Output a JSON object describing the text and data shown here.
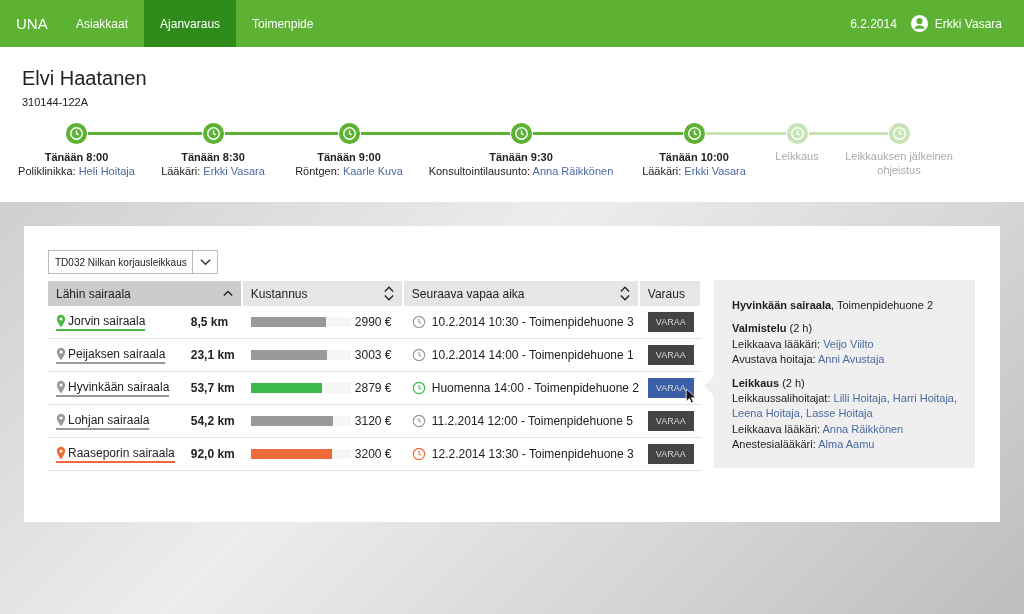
{
  "nav": {
    "logo": "UNA",
    "tabs": [
      {
        "label": "Asiakkaat",
        "selected": false
      },
      {
        "label": "Ajanvaraus",
        "selected": true
      },
      {
        "label": "Toimenpide",
        "selected": false
      }
    ],
    "date": "6.2.2014",
    "user": "Erkki Vasara"
  },
  "patient": {
    "name": "Elvi Haatanen",
    "id": "310144-122A"
  },
  "timeline": [
    {
      "done": true,
      "time": "Tänään 8:00",
      "role": "Poliklinikka:",
      "person": "Heli Hoitaja"
    },
    {
      "done": true,
      "time": "Tänään 8:30",
      "role": "Lääkäri:",
      "person": "Erkki Vasara"
    },
    {
      "done": true,
      "time": "Tänään 9:00",
      "role": "Röntgen:",
      "person": "Kaarle Kuva"
    },
    {
      "done": true,
      "time": "Tänään 9:30",
      "role": "Konsultointilausunto:",
      "person": "Anna Räikkönen"
    },
    {
      "done": true,
      "time": "Tänään 10:00",
      "role": "Lääkäri:",
      "person": "Erkki Vasara"
    },
    {
      "done": false,
      "label": "Leikkaus"
    },
    {
      "done": false,
      "label": "Leikkauksen jälkeinen ohjeistus"
    }
  ],
  "procedure_select": {
    "value": "TD032 Nilkan korjausleikkaus"
  },
  "table": {
    "columns": [
      {
        "label": "Lähin sairaala",
        "sortable": true,
        "selected": true
      },
      {
        "label": "Kustannus",
        "sortable": true,
        "selected": false
      },
      {
        "label": "Seuraava vapaa aika",
        "sortable": true,
        "selected": false
      },
      {
        "label": "Varaus",
        "sortable": false,
        "selected": false
      }
    ],
    "rows": [
      {
        "hospital": "Jorvin sairaala",
        "closest": true,
        "farthest": false,
        "distance": "8,5 km",
        "level": 0.75,
        "cheapest": false,
        "priciest": false,
        "cost": "2990 €",
        "time": "10.2.2014 10:30 - Toimenpidehuone 3",
        "button": "VARAA",
        "selected": false
      },
      {
        "hospital": "Peijaksen sairaala",
        "closest": false,
        "farthest": false,
        "distance": "23,1 km",
        "level": 0.76,
        "cheapest": false,
        "priciest": false,
        "cost": "3003 €",
        "time": "10.2.2014 14:00 - Toimenpidehuone 1",
        "button": "VARAA",
        "selected": false
      },
      {
        "hospital": "Hyvinkään sairaala",
        "closest": false,
        "farthest": false,
        "distance": "53,7 km",
        "level": 0.71,
        "cheapest": true,
        "priciest": false,
        "cost": "2879 €",
        "time": "Huomenna 14:00 - Toimenpidehuone 2",
        "button": "VARAA",
        "selected": true
      },
      {
        "hospital": "Lohjan sairaala",
        "closest": false,
        "farthest": false,
        "distance": "54,2 km",
        "level": 0.82,
        "cheapest": false,
        "priciest": false,
        "cost": "3120 €",
        "time": "11.2.2014 12:00 - Toimenpidehuone 5",
        "button": "VARAA",
        "selected": false
      },
      {
        "hospital": "Raaseporin sairaala",
        "closest": false,
        "farthest": true,
        "distance": "92,0 km",
        "level": 0.81,
        "cheapest": false,
        "priciest": true,
        "cost": "3200 €",
        "time": "12.2.2014 13:30 - Toimenpidehuone 3",
        "button": "VARAA",
        "selected": false
      }
    ]
  },
  "details": {
    "title": "**Hyvinkään sairaala**, Toimenpidehuone 2",
    "sections": [
      {
        "heading": "**Valmistelu** (2 h)",
        "lines": [
          {
            "label": "Leikkaava lääkäri:",
            "people": [
              "Veijo Viilto"
            ]
          },
          {
            "label": "Avustava hoitaja:",
            "people": [
              "Anni Avustaja"
            ]
          }
        ]
      },
      {
        "heading": "**Leikkaus** (2 h)",
        "lines": [
          {
            "label": "Leikkaussalihoitajat:",
            "people": [
              "Lilli Hoitaja,",
              "Harri Hoitaja,",
              "Leena Hoitaja,",
              "Lasse Hoitaja"
            ]
          },
          {
            "label": "Leikkaava lääkäri:",
            "people": [
              "Anna Räikkönen"
            ]
          },
          {
            "label": "Anestesialääkäri:",
            "people": [
              "Alma Aamu"
            ]
          }
        ]
      }
    ]
  }
}
